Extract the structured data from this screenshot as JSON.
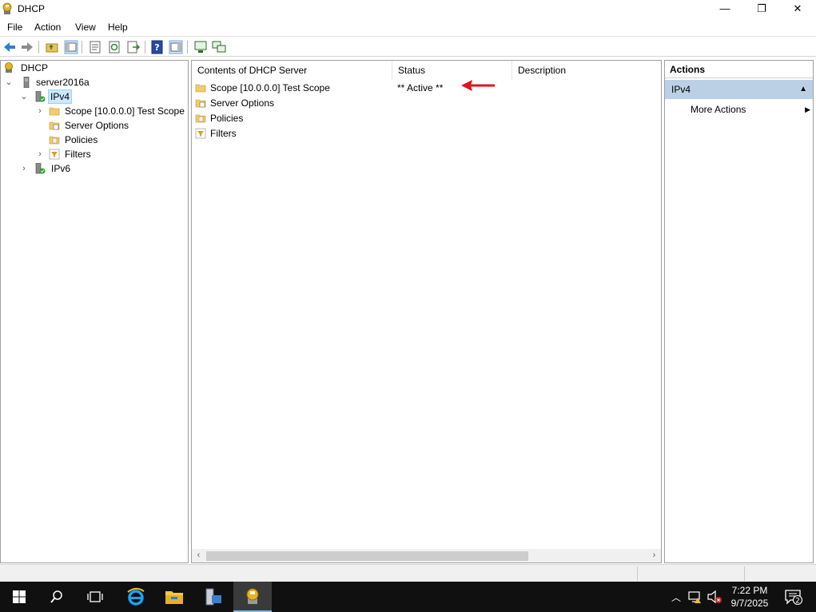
{
  "window": {
    "title": "DHCP",
    "minimize_glyph": "—",
    "maximize_glyph": "❐",
    "close_glyph": "✕"
  },
  "menu": {
    "items": [
      "File",
      "Action",
      "View",
      "Help"
    ]
  },
  "toolbar": {
    "buttons": [
      "back-icon",
      "forward-icon",
      "up-folder-icon",
      "show-hide-tree-icon",
      "properties-icon",
      "refresh-icon",
      "export-list-icon",
      "help-icon",
      "action-pane-icon",
      "server-add-icon",
      "server-authorize-icon"
    ]
  },
  "tree": {
    "root": "DHCP",
    "server": "server2016a",
    "ipv4": "IPv4",
    "scope": "Scope [10.0.0.0] Test Scope",
    "server_options": "Server Options",
    "policies": "Policies",
    "filters": "Filters",
    "ipv6": "IPv6"
  },
  "list": {
    "columns": [
      "Contents of DHCP Server",
      "Status",
      "Description"
    ],
    "rows": [
      {
        "name": "Scope [10.0.0.0] Test Scope",
        "status": "** Active **",
        "icon": "folder-icon"
      },
      {
        "name": "Server Options",
        "status": "",
        "icon": "server-options-icon"
      },
      {
        "name": "Policies",
        "status": "",
        "icon": "policies-icon"
      },
      {
        "name": "Filters",
        "status": "",
        "icon": "filters-icon"
      }
    ],
    "annotation_color": "#e0141c"
  },
  "actions": {
    "title": "Actions",
    "group": "IPv4",
    "more_actions": "More Actions"
  },
  "taskbar": {
    "time": "7:22 PM",
    "date": "9/7/2025",
    "notification_count": "2"
  }
}
